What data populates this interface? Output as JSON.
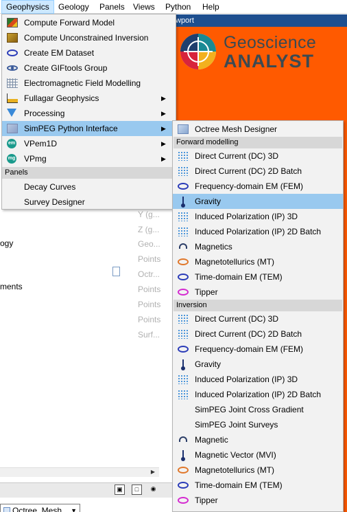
{
  "menubar": {
    "items": [
      "Geophysics",
      "Geology",
      "Panels",
      "Views",
      "Python",
      "Help"
    ]
  },
  "viewport_title": "wport",
  "logo": {
    "line1": "Geoscience",
    "line2": "ANALYST"
  },
  "background": {
    "left_texts": [
      "ogy",
      "ments"
    ],
    "prop_texts": [
      "Y (g...",
      "Z (g...",
      "Geo...",
      "Points",
      "Octr...",
      "Points",
      "Points",
      "Points",
      "Surf..."
    ],
    "combo_value": "Octree_Mesh"
  },
  "geophysics_menu": {
    "items": [
      {
        "label": "Compute Forward Model",
        "icon": "forward-model-icon",
        "submenu": false
      },
      {
        "label": "Compute Unconstrained Inversion",
        "icon": "cube-icon",
        "submenu": false
      },
      {
        "label": "Create EM Dataset",
        "icon": "coil-icon",
        "submenu": false
      },
      {
        "label": "Create GIFtools Group",
        "icon": "eye-icon",
        "submenu": false
      },
      {
        "label": "Electromagnetic Field Modelling",
        "icon": "grid-icon",
        "submenu": false
      },
      {
        "label": "Fullagar Geophysics",
        "icon": "chart-icon",
        "submenu": true
      },
      {
        "label": "Processing",
        "icon": "funnel-icon",
        "submenu": true
      },
      {
        "label": "SimPEG Python Interface",
        "icon": "simpeg-icon",
        "submenu": true
      },
      {
        "label": "VPem1D",
        "icon": "em-icon",
        "submenu": true
      },
      {
        "label": "VPmg",
        "icon": "mg-icon",
        "submenu": true
      }
    ],
    "section": "Panels",
    "panel_items": [
      "Decay Curves",
      "Survey Designer"
    ]
  },
  "simpeg_menu": {
    "top_item": "Octree Mesh Designer",
    "forward_section": "Forward modelling",
    "forward_items": [
      {
        "label": "Direct Current (DC) 3D",
        "icon": "dc-icon"
      },
      {
        "label": "Direct Current (DC) 2D Batch",
        "icon": "dc-icon"
      },
      {
        "label": "Frequency-domain EM (FEM)",
        "icon": "coil-icon"
      },
      {
        "label": "Gravity",
        "icon": "gravity-icon"
      },
      {
        "label": "Induced Polarization (IP) 3D",
        "icon": "dc-icon"
      },
      {
        "label": "Induced Polarization (IP) 2D Batch",
        "icon": "dc-icon"
      },
      {
        "label": "Magnetics",
        "icon": "magnet-icon"
      },
      {
        "label": "Magnetotellurics (MT)",
        "icon": "mt-coil-icon"
      },
      {
        "label": "Time-domain EM (TEM)",
        "icon": "coil-icon"
      },
      {
        "label": "Tipper",
        "icon": "tipper-coil-icon"
      }
    ],
    "inversion_section": "Inversion",
    "inversion_items": [
      {
        "label": "Direct Current (DC) 3D",
        "icon": "dc-icon"
      },
      {
        "label": "Direct Current (DC) 2D Batch",
        "icon": "dc-icon"
      },
      {
        "label": "Frequency-domain EM (FEM)",
        "icon": "coil-icon"
      },
      {
        "label": "Gravity",
        "icon": "gravity-icon"
      },
      {
        "label": "Induced Polarization (IP) 3D",
        "icon": "dc-icon"
      },
      {
        "label": "Induced Polarization (IP) 2D Batch",
        "icon": "dc-icon"
      },
      {
        "label": "SimPEG Joint Cross Gradient",
        "icon": ""
      },
      {
        "label": "SimPEG Joint Surveys",
        "icon": ""
      },
      {
        "label": "Magnetic",
        "icon": "magnet-icon"
      },
      {
        "label": "Magnetic Vector (MVI)",
        "icon": "gravity-icon"
      },
      {
        "label": "Magnetotellurics (MT)",
        "icon": "mt-coil-icon"
      },
      {
        "label": "Time-domain EM (TEM)",
        "icon": "coil-icon"
      },
      {
        "label": "Tipper",
        "icon": "tipper-coil-icon"
      }
    ]
  },
  "colors": {
    "highlight": "#99c9ef",
    "viewport_orange": "#ff5a00",
    "title_blue": "#1e4f8f"
  }
}
